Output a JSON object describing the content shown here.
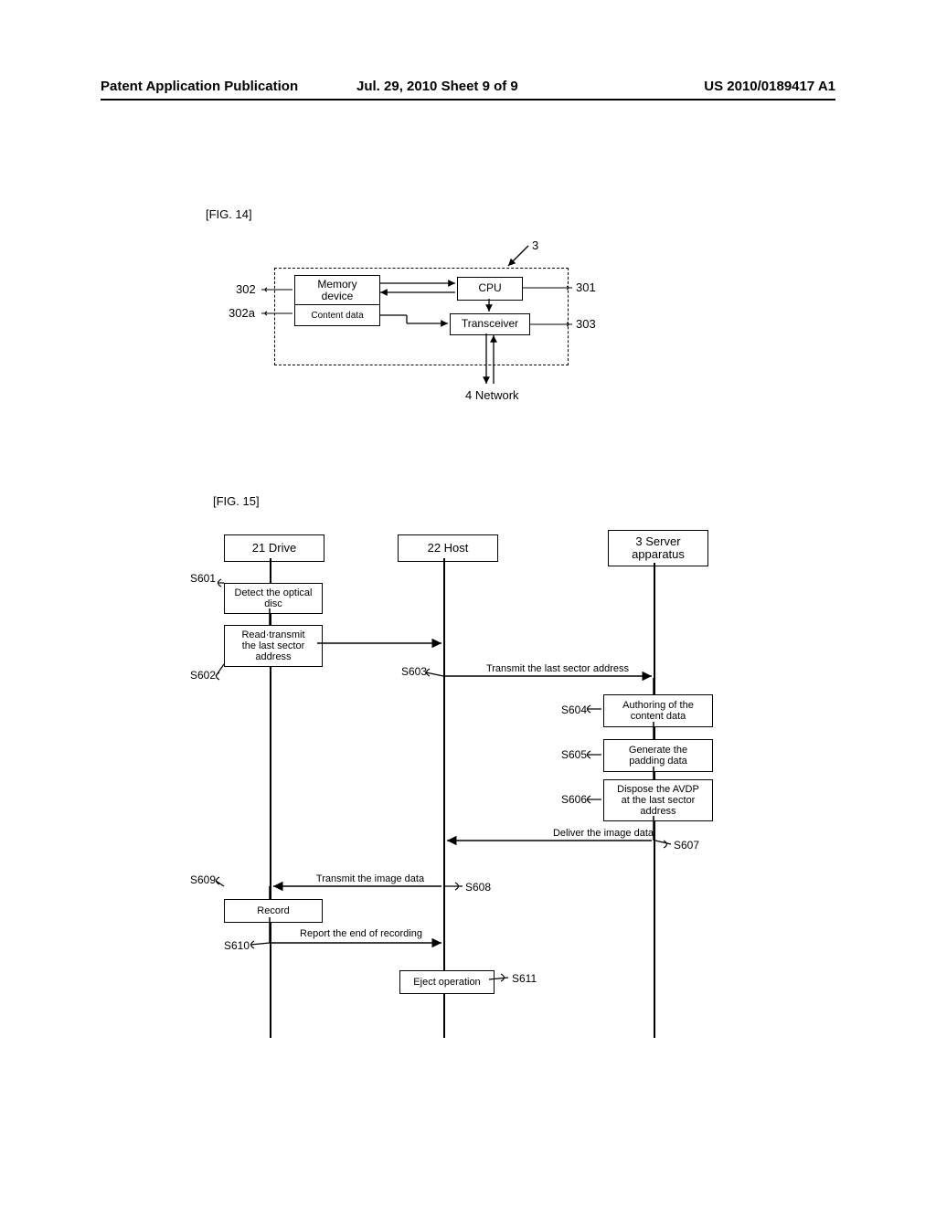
{
  "header": {
    "left": "Patent Application Publication",
    "middle": "Jul. 29, 2010  Sheet 9 of 9",
    "right": "US 2010/0189417 A1"
  },
  "fig14": {
    "caption": "[FIG. 14]",
    "ref_main": "3",
    "ref_302": "302",
    "ref_302a": "302a",
    "ref_301": "301",
    "ref_303": "303",
    "memory_device": "Memory\ndevice",
    "content_data": "Content data",
    "cpu": "CPU",
    "transceiver": "Transceiver",
    "network": "4 Network"
  },
  "fig15": {
    "caption": "[FIG. 15]",
    "lane_drive": "21 Drive",
    "lane_host": "22 Host",
    "lane_server": "3 Server\napparatus",
    "s601": {
      "id": "S601",
      "text": "Detect the optical\ndisc"
    },
    "s602": {
      "id": "S602",
      "text": "Read·transmit\nthe last sector\naddress"
    },
    "s603": {
      "id": "S603",
      "text": "Transmit the last sector address"
    },
    "s604": {
      "id": "S604",
      "text": "Authoring of the\ncontent data"
    },
    "s605": {
      "id": "S605",
      "text": "Generate the\npadding data"
    },
    "s606": {
      "id": "S606",
      "text": "Dispose the AVDP\nat the last sector\naddress"
    },
    "s607": {
      "id": "S607",
      "text": "Deliver the image data"
    },
    "s608": {
      "id": "S608",
      "text": "Transmit the image data"
    },
    "s609": {
      "id": "S609",
      "text": "Record"
    },
    "s610": {
      "id": "S610",
      "text": "Report the end of recording"
    },
    "s611": {
      "id": "S611",
      "text": "Eject operation"
    }
  }
}
